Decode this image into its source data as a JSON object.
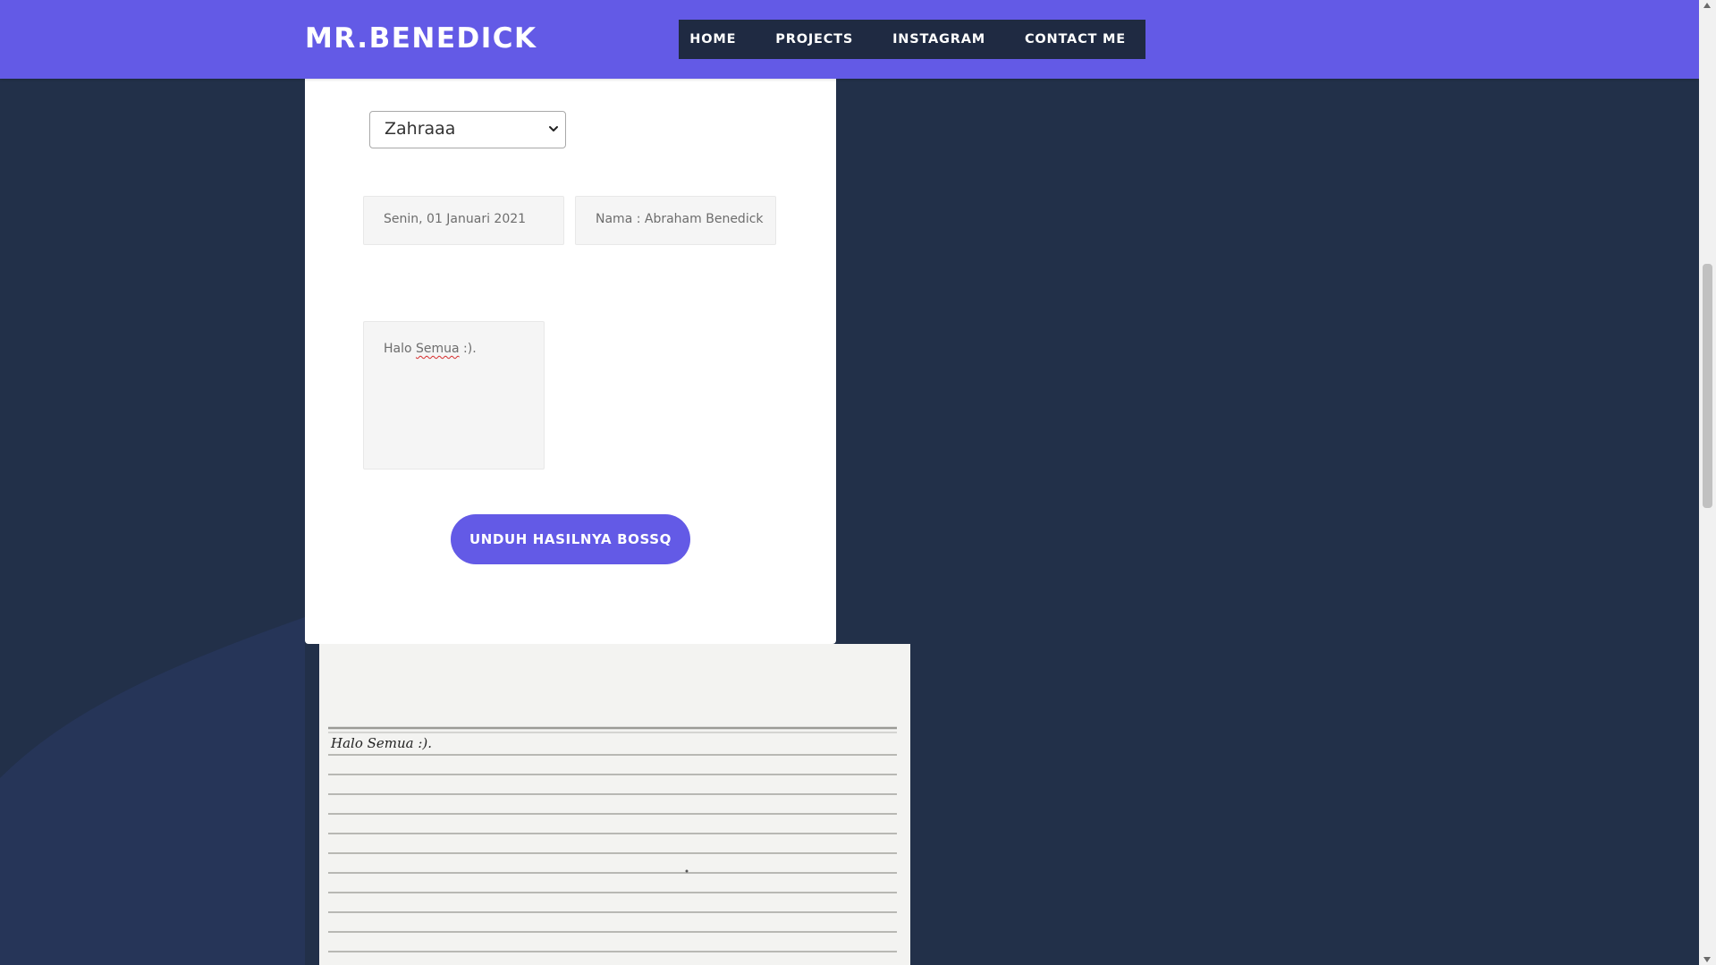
{
  "navbar": {
    "brand": "MR.BENEDICK",
    "links": [
      "HOME",
      "PROJECTS",
      "INSTAGRAM",
      "CONTACT ME"
    ],
    "background_color": "#635ae6",
    "menu_background_color": "#1f2a42"
  },
  "form": {
    "font_select": {
      "selected": "Zahraaa",
      "icon": "chevron-down-icon"
    },
    "date_field": {
      "value": "Senin, 01 Januari 2021"
    },
    "name_field": {
      "value": "Nama : Abraham Benedick"
    },
    "message": {
      "first_word": "Halo ",
      "misspelled_word": "Semua",
      "rest": " :)."
    },
    "download_button": {
      "label": "UNDUH HASILNYA BOSSQ",
      "color": "#635ae6"
    }
  },
  "preview": {
    "handwritten_text": "Halo Semua :)."
  },
  "colors": {
    "page_background": "#223049",
    "card_background": "#ffffff",
    "input_background": "#f5f5f5"
  }
}
